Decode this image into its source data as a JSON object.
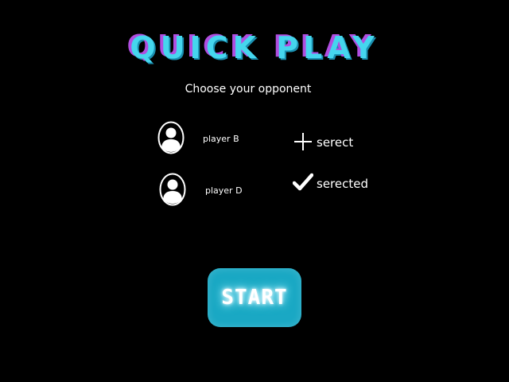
{
  "screen": {
    "title": "QUICK PLAY",
    "subtitle": "Choose your opponent"
  },
  "players": [
    {
      "name": "player B",
      "avatar_icon": "user-avatar-icon"
    },
    {
      "name": "player D",
      "avatar_icon": "user-avatar-icon"
    }
  ],
  "select_options": [
    {
      "label": "serect",
      "icon": "plus-icon"
    },
    {
      "label": "serected",
      "icon": "checkmark-icon"
    }
  ],
  "start_button": {
    "label": "START"
  },
  "colors": {
    "background": "#000000",
    "title_cyan": "#45d6ee",
    "title_purple": "#b04ee0",
    "button_teal": "#1aa8c4",
    "text": "#ffffff"
  }
}
